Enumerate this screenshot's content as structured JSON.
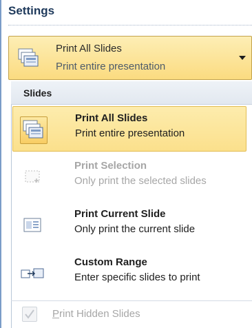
{
  "settings": {
    "title": "Settings"
  },
  "print_dropdown": {
    "selected_title": "Print All Slides",
    "selected_subtitle": "Print entire presentation"
  },
  "menu": {
    "section_label": "Slides",
    "items": [
      {
        "title": "Print All Slides",
        "subtitle": "Print entire presentation",
        "icon": "print-all-slides-icon",
        "state": "selected"
      },
      {
        "title": "Print Selection",
        "subtitle": "Only print the selected slides",
        "icon": "print-selection-icon",
        "state": "disabled"
      },
      {
        "title": "Print Current Slide",
        "subtitle": "Only print the current slide",
        "icon": "print-current-slide-icon",
        "state": "normal"
      },
      {
        "title": "Custom Range",
        "subtitle": "Enter specific slides to print",
        "icon": "custom-range-icon",
        "state": "normal"
      }
    ]
  },
  "hidden_slides": {
    "label_underlined_char": "P",
    "label_rest": "rint Hidden Slides",
    "checked": true,
    "enabled": false
  },
  "colors": {
    "highlight": "#fbe08c",
    "text": "#1e395b",
    "disabled_text": "#a6a6a6"
  }
}
